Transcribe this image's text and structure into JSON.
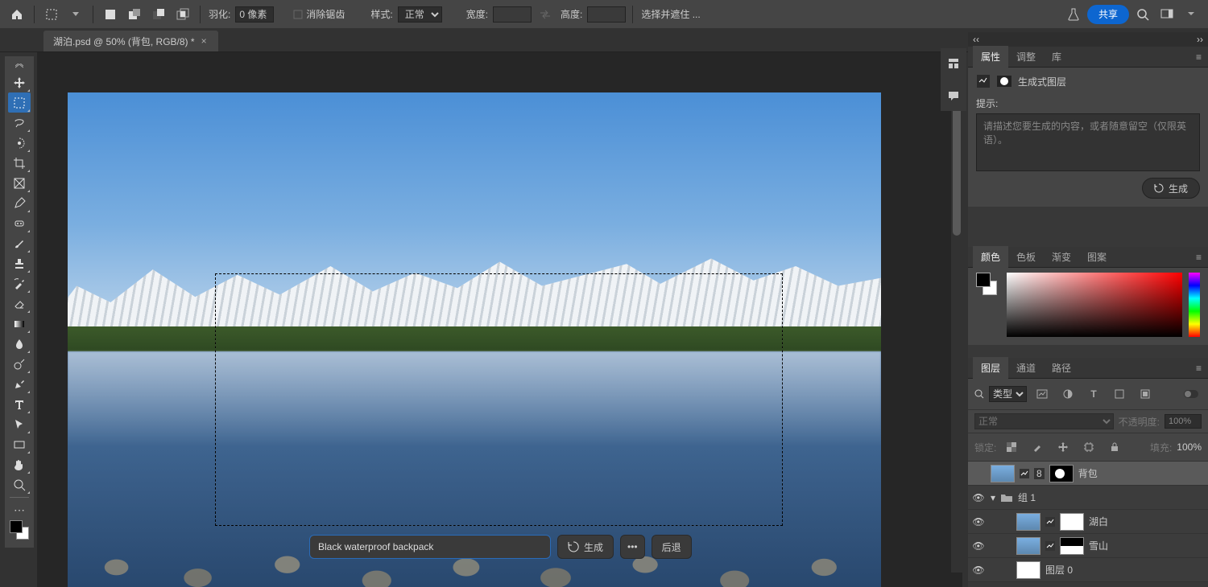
{
  "topbar": {
    "feather_label": "羽化:",
    "feather_value": "0 像素",
    "antialias_label": "消除锯齿",
    "style_label": "样式:",
    "style_value": "正常",
    "width_label": "宽度:",
    "height_label": "高度:",
    "select_mask_label": "选择并遮住 ...",
    "share_label": "共享"
  },
  "doc": {
    "tab_title": "湖泊.psd @ 50% (背包, RGB/8) *"
  },
  "ctx": {
    "prompt_value": "Black waterproof backpack",
    "generate_label": "生成",
    "back_label": "后退"
  },
  "props": {
    "tabs": {
      "properties": "属性",
      "adjust": "调整",
      "library": "库"
    },
    "layer_type_label": "生成式图层",
    "hint_label": "提示:",
    "hint_placeholder": "请描述您要生成的内容，或者随意留空（仅限英语）。",
    "generate_label": "生成"
  },
  "color": {
    "tabs": {
      "color": "颜色",
      "swatches": "色板",
      "gradient": "渐变",
      "patterns": "图案"
    }
  },
  "layers": {
    "tabs": {
      "layers": "图层",
      "channels": "通道",
      "paths": "路径"
    },
    "filter_label": "类型",
    "blend_value": "正常",
    "opacity_label": "不透明度:",
    "opacity_value": "100%",
    "lock_label": "锁定:",
    "fill_label": "填充:",
    "fill_value": "100%",
    "items": [
      {
        "name": "背包",
        "selected": true,
        "vis": false,
        "thumb": "img",
        "mask": "shape",
        "badge": "8"
      },
      {
        "name": "组 1",
        "group": true,
        "vis": true
      },
      {
        "name": "湖白",
        "indent": 2,
        "vis": true,
        "thumb": "img",
        "mask": "white"
      },
      {
        "name": "雪山",
        "indent": 2,
        "vis": true,
        "thumb": "img",
        "mask": "bw"
      },
      {
        "name": "图层 0",
        "indent": 2,
        "vis": true,
        "thumb": "white"
      }
    ]
  }
}
